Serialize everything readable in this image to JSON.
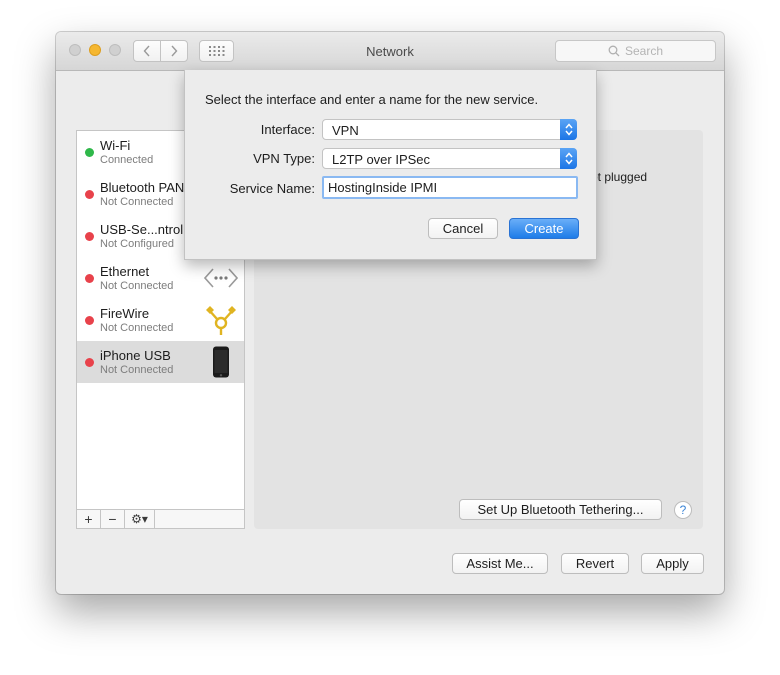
{
  "window": {
    "title": "Network"
  },
  "toolbar": {
    "search_placeholder": "Search"
  },
  "services": [
    {
      "name": "Wi-Fi",
      "status": "Connected",
      "dot_color": "#2fb84a",
      "icon": "none"
    },
    {
      "name": "Bluetooth PAN",
      "status": "Not Connected",
      "dot_color": "#e8424b",
      "icon": "bluetooth-icon"
    },
    {
      "name": "USB-Se...ntroller",
      "status": "Not Configured",
      "dot_color": "#e8424b",
      "icon": "usb-icon"
    },
    {
      "name": "Ethernet",
      "status": "Not Connected",
      "dot_color": "#e8424b",
      "icon": "ethernet-icon"
    },
    {
      "name": "FireWire",
      "status": "Not Connected",
      "dot_color": "#e8424b",
      "icon": "firewire-icon"
    },
    {
      "name": "iPhone USB",
      "status": "Not Connected",
      "dot_color": "#e8424b",
      "icon": "iphone-icon",
      "selected": true
    }
  ],
  "sidebar_tools": {
    "add": "+",
    "remove": "−",
    "gear": "⚙▾"
  },
  "detail": {
    "status_text": "ot plugged",
    "tether_button": "Set Up Bluetooth Tethering...",
    "help_button": "?"
  },
  "footer": {
    "assist": "Assist Me...",
    "revert": "Revert",
    "apply": "Apply"
  },
  "dialog": {
    "message": "Select the interface and enter a name for the new service.",
    "interface_label": "Interface:",
    "interface_value": "VPN",
    "vpn_type_label": "VPN Type:",
    "vpn_type_value": "L2TP over IPSec",
    "service_name_label": "Service Name:",
    "service_name_value": "HostingInside IPMI",
    "cancel": "Cancel",
    "create": "Create"
  },
  "colors": {
    "accent": "#1e7ce8",
    "connected": "#2fb84a",
    "disconnected": "#e8424b"
  }
}
